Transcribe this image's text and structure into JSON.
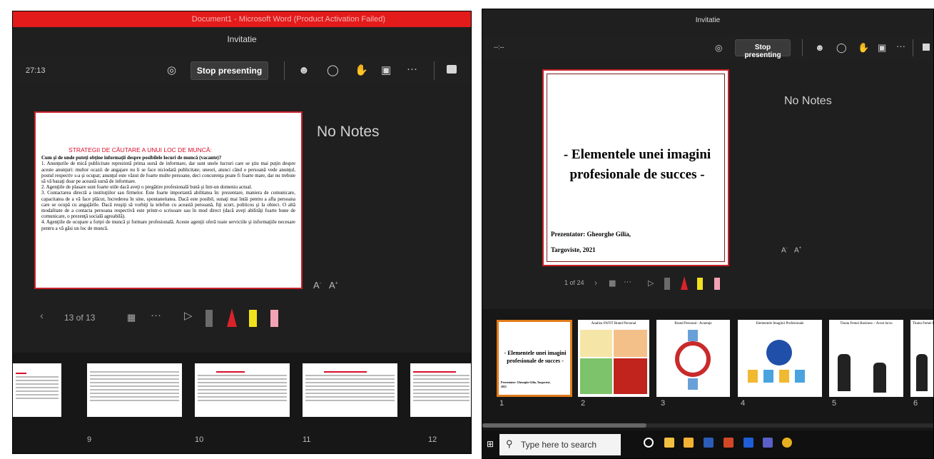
{
  "left": {
    "window_title": "Document1 - Microsoft Word (Product Activation Failed)",
    "meeting_title": "Invitatie",
    "timer": "27:13",
    "stop_label": "Stop presenting",
    "slide": {
      "heading": "STRATEGII DE CĂUTARE A UNUI LOC DE MUNCĂ:",
      "question": "Cum şi de unde puteţi obţine informaţii despre posibilele locuri de muncă (vacante)?",
      "p1": "1.  Anunţurile de mică publicitate reprezintă prima sursă de informare, dar sunt unele lucruri care se ştiu mai puţin despre aceste anunţuri: multor ocazii de angajare nu li se face niciodată publicitate; uneori, atunci când o persoană vede anunţul, postul respectiv s-a şi ocupat; anunţul este văzut de foarte multe persoane, deci concurenţa poate fi foarte mare, dar nu trebuie să vă bazaţi doar pe această sursă de informare.",
      "p2": "2. Agenţiile de plasare sunt foarte utile dacă aveţi o pregătire profesională bună şi într-un domeniu actual.",
      "p3": "3. Contactarea directă a instituţiilor sau firmelor. Este foarte importantă abilitatea în: prezentare, maniera de comunicare, capacitatea de a vă face plăcut, încrederea în sine, spontaneitatea. Dacă este posibil, sunaţi mai întâi pentru a afla persoana care se ocupă cu angajările. Dacă reuşiţi să vorbiţi la telefon cu această persoană, fiţi scurt, politicos şi la obiect. O altă modalitate de a contacta persoana respectivă este printr-o scrisoare sau în mod direct (dacă aveţi abilităţi foarte bune de comunicare, o prezenţă socială agreabilă).",
      "p4": " 4. Agenţiile de ocupare a forţei de muncă şi formare profesională. Aceste agenţii oferă toate serviciile şi informaţiile necesare pentru a vă găsi un loc de muncă."
    },
    "notes": "No Notes",
    "font_small": "A",
    "font_large": "A",
    "counter": "13 of 13",
    "more": "···",
    "thumb_numbers": [
      "9",
      "10",
      "11",
      "12"
    ]
  },
  "right": {
    "meeting_title": "Invitatie",
    "timer": "--:--",
    "stop_label": "Stop presenting",
    "notes": "No Notes",
    "font_small": "A",
    "font_large": "A",
    "slide": {
      "title": "- Elementele unei imagini profesionale de succes -",
      "presenter": "Prezentator: Gheorghe Gilia,",
      "place": "Targoviste,  2021"
    },
    "counter": "1 of 24",
    "more": "···",
    "thumbs": [
      {
        "num": "1",
        "title": "- Elementele unei imagini profesionale de succes -",
        "sub": "Prezentator: Gheorghe Gilia, Targoviste, 2021"
      },
      {
        "num": "2",
        "title": "Analiza SWOT Brand Personal"
      },
      {
        "num": "3",
        "title": "Brand Personal - Avantaje"
      },
      {
        "num": "4",
        "title": "Elementele Imaginii Profesionale"
      },
      {
        "num": "5",
        "title": "Tinuta Femei Business – Acest lucru"
      },
      {
        "num": "6",
        "title": "Tinuta Femei Business"
      }
    ],
    "search_placeholder": "Type here to search"
  },
  "colors": {
    "accent_red": "#e31b1b",
    "slide_border": "#c9202a",
    "current_thumb": "#e07b1a",
    "pane_bg": "#1f1f1f"
  }
}
